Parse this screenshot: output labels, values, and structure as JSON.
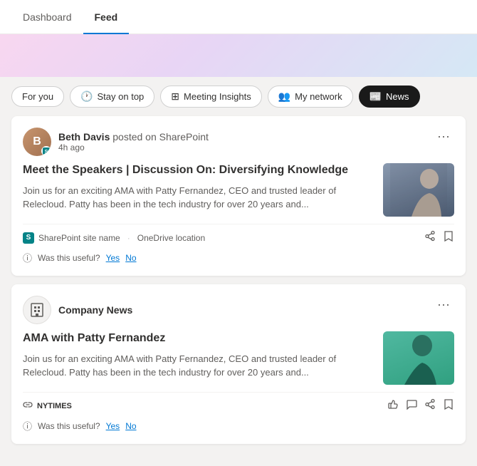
{
  "nav": {
    "items": [
      {
        "id": "dashboard",
        "label": "Dashboard",
        "active": false
      },
      {
        "id": "feed",
        "label": "Feed",
        "active": true
      }
    ]
  },
  "filter_tabs": [
    {
      "id": "for-you",
      "label": "For you",
      "icon": "",
      "active": false
    },
    {
      "id": "stay-on-top",
      "label": "Stay on top",
      "icon": "🕐",
      "active": false
    },
    {
      "id": "meeting-insights",
      "label": "Meeting Insights",
      "icon": "⊞",
      "active": false
    },
    {
      "id": "my-network",
      "label": "My network",
      "icon": "👥",
      "active": false
    },
    {
      "id": "news",
      "label": "News",
      "icon": "📰",
      "active": true
    }
  ],
  "cards": [
    {
      "id": "card1",
      "author": "Beth Davis",
      "posted_text": "posted on SharePoint",
      "time": "4h ago",
      "title": "Meet the Speakers | Discussion On: Diversifying Knowledge",
      "description": "Join us for an exciting AMA with Patty Fernandez, CEO and trusted leader of Relecloud. Patty has been in the tech industry for over 20 years and...",
      "source_name": "SharePoint site name",
      "source_secondary": "OneDrive location",
      "feedback_label": "Was this useful?",
      "feedback_yes": "Yes",
      "feedback_no": "No",
      "image_type": "person1"
    },
    {
      "id": "card2",
      "author": "Company News",
      "is_company": true,
      "time": "",
      "title": "AMA with Patty Fernandez",
      "description": "Join us for an exciting AMA with Patty Fernandez, CEO and trusted leader of Relecloud. Patty has been in the tech industry for over 20 years and...",
      "source_name": "NYTIMES",
      "source_secondary": "",
      "feedback_label": "Was this useful?",
      "feedback_yes": "Yes",
      "feedback_no": "No",
      "image_type": "person2"
    }
  ]
}
